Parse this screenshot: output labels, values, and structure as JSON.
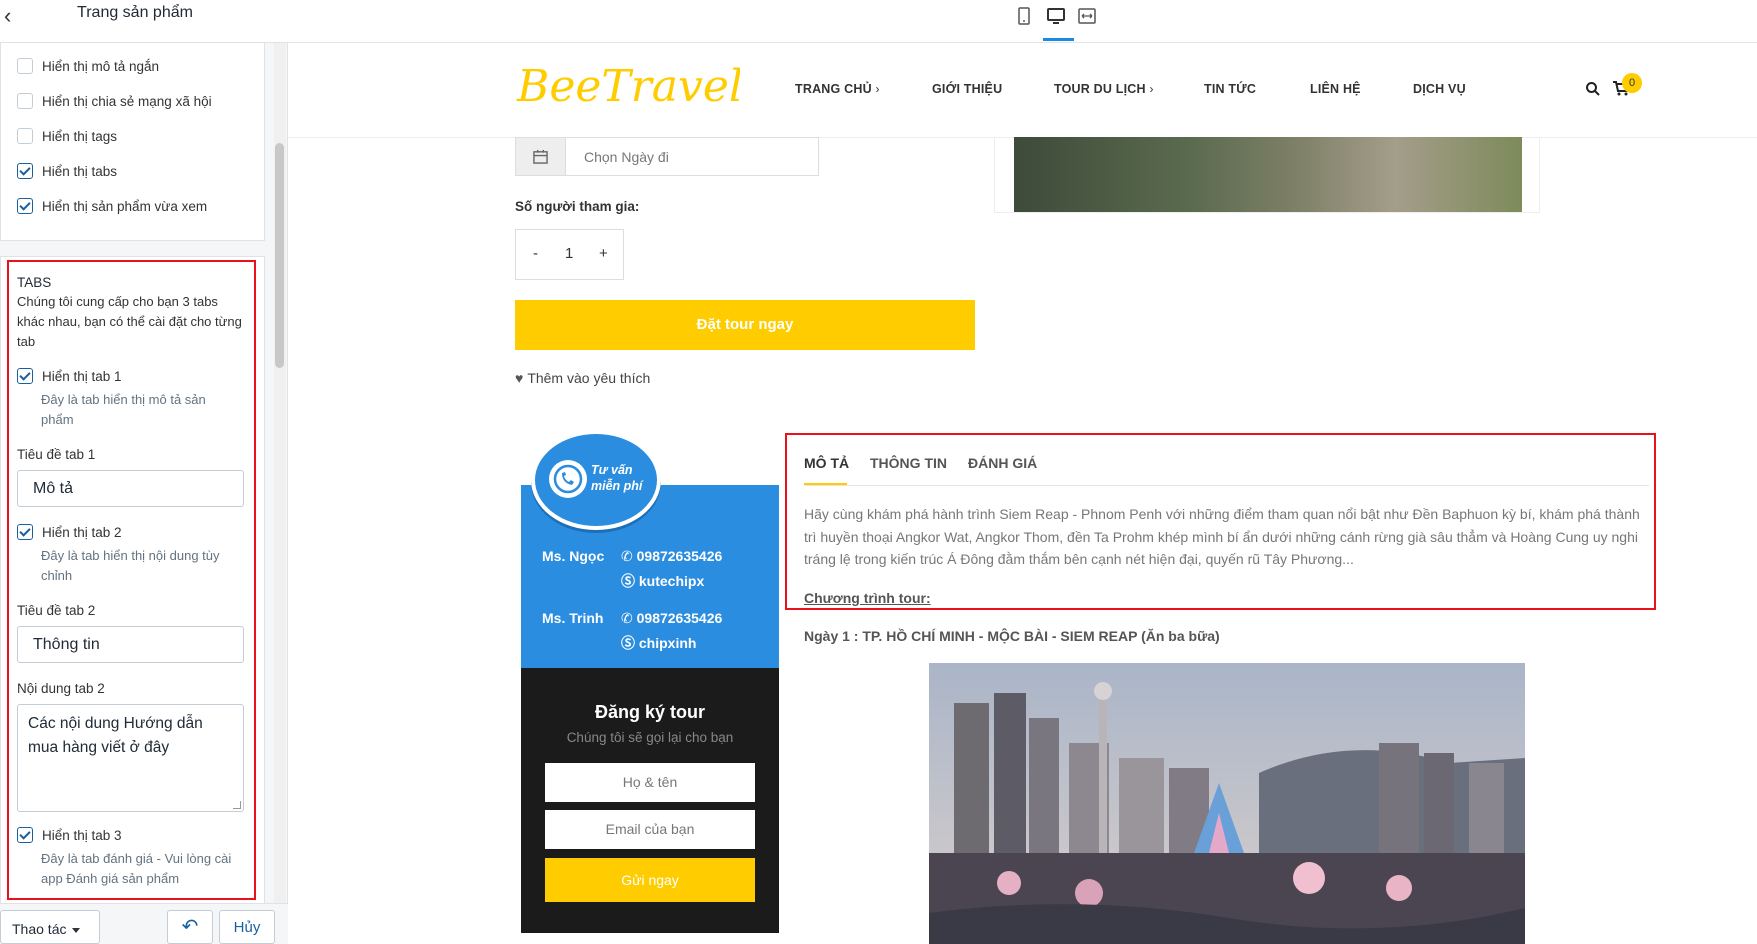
{
  "panel": {
    "title": "Trang sản phẩm",
    "checkboxes_top": [
      {
        "label": "Hiển thị mô tả ngắn",
        "checked": false
      },
      {
        "label": "Hiển thị chia sẻ mạng xã hội",
        "checked": false
      },
      {
        "label": "Hiển thị tags",
        "checked": false
      },
      {
        "label": "Hiển thị tabs",
        "checked": true
      },
      {
        "label": "Hiển thị sản phẩm vừa xem",
        "checked": true
      }
    ],
    "tabs_section": {
      "title": "TABS",
      "description": "Chúng tôi cung cấp cho bạn 3 tabs khác nhau, bạn có thể cài đặt cho từng tab",
      "tab1": {
        "label": "Hiển thị tab 1",
        "checked": true,
        "hint": "Đây là tab hiển thị mô tả sản phẩm",
        "title_label": "Tiêu đề tab 1",
        "title_value": "Mô tả"
      },
      "tab2": {
        "label": "Hiển thị tab 2",
        "checked": true,
        "hint": "Đây là tab hiển thị nội dung tùy chỉnh",
        "title_label": "Tiêu đề tab 2",
        "title_value": "Thông tin",
        "content_label": "Nội dung tab 2",
        "content_value": "Các nội dung Hướng dẫn mua hàng viết ở đây"
      },
      "tab3": {
        "label": "Hiển thị tab 3",
        "checked": true,
        "hint": "Đây là tab đánh giá - Vui lòng cài app Đánh giá sản phẩm"
      }
    },
    "footer": {
      "action_label": "Thao tác",
      "cancel_label": "Hủy"
    }
  },
  "site": {
    "logo": "BeeTravel",
    "brand_color": "#ffcc00",
    "nav": [
      {
        "label": "TRANG CHỦ",
        "submenu": true
      },
      {
        "label": "GIỚI THIỆU",
        "submenu": false
      },
      {
        "label": "TOUR DU LỊCH",
        "submenu": true
      },
      {
        "label": "TIN TỨC",
        "submenu": false
      },
      {
        "label": "LIÊN HỆ",
        "submenu": false
      },
      {
        "label": "DỊCH VỤ",
        "submenu": false
      }
    ],
    "cart_count": "0"
  },
  "booking": {
    "date_placeholder": "Chọn Ngày đi",
    "qty_label": "Số người tham gia:",
    "qty_minus": "-",
    "qty_value": "1",
    "qty_plus": "+",
    "book_button": "Đặt tour ngay",
    "wishlist": "Thêm vào yêu thích"
  },
  "consult": {
    "bubble_line1": "Tư vấn",
    "bubble_line2": "miễn phí",
    "contacts": [
      {
        "name": "Ms. Ngọc",
        "phone": "09872635426",
        "skype": "kutechipx"
      },
      {
        "name": "Ms. Trinh",
        "phone": "09872635426",
        "skype": "chipxinh"
      }
    ],
    "register_title": "Đăng ký tour",
    "register_sub": "Chúng tôi sẽ gọi lại cho bạn",
    "name_placeholder": "Họ & tên",
    "email_placeholder": "Email của bạn",
    "send_button": "Gửi ngay"
  },
  "product_tabs": {
    "tabs": [
      "MÔ TẢ",
      "THÔNG TIN",
      "ĐÁNH GIÁ"
    ],
    "active": 0,
    "description": "Hãy cùng khám phá hành trình Siem Reap - Phnom Penh với những điểm tham quan nổi bật như Đền Baphuon kỳ bí, khám phá thành trì huyền thoại Angkor Wat, Angkor Thom, đền Ta Prohm khép mình bí ẩn dưới những cánh rừng già sâu thẳm và Hoàng Cung uy nghi tráng lệ trong kiến trúc Á Đông đằm thắm bên cạnh nét hiện đại, quyến rũ Tây Phương...",
    "program_title": "Chương trình tour:",
    "day1": "Ngày 1 : TP. HỒ CHÍ MINH - MỘC BÀI - SIEM REAP (Ăn ba bữa)"
  },
  "highlight_color": "#e8111d"
}
